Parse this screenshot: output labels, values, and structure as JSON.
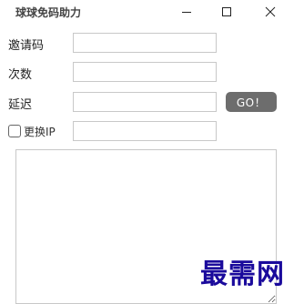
{
  "window": {
    "title": "球球免码助力",
    "controls": {
      "minimize_icon": "minimize-icon",
      "maximize_icon": "maximize-icon",
      "close_icon": "close-icon"
    }
  },
  "form": {
    "invite_label": "邀请码",
    "invite_value": "",
    "count_label": "次数",
    "count_value": "",
    "delay_label": "延迟",
    "delay_value": "",
    "go_label": "GO！",
    "change_ip_label": "更换IP",
    "change_ip_checked": false,
    "ip_value": ""
  },
  "log": {
    "content": ""
  },
  "watermark": {
    "text": "最需网"
  }
}
